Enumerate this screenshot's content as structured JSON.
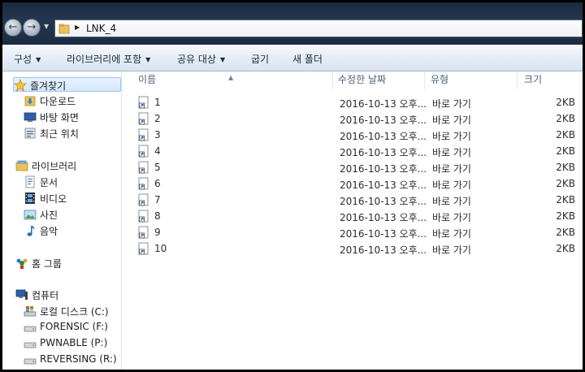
{
  "address": {
    "path": "LNK_4"
  },
  "toolbar": {
    "organize": "구성",
    "include_library": "라이브러리에 포함",
    "share_with": "공유 대상",
    "burn": "굽기",
    "new_folder": "새 폴더"
  },
  "nav": {
    "favorites": "즐겨찾기",
    "downloads": "다운로드",
    "desktop": "바탕 화면",
    "recent": "최근 위치",
    "libraries": "라이브러리",
    "documents": "문서",
    "videos": "비디오",
    "pictures": "사진",
    "music": "음악",
    "homegroup": "홈 그룹",
    "computer": "컴퓨터",
    "local_disk": "로컬 디스크 (C:)",
    "drive_f": "FORENSIC (F:)",
    "drive_p": "PWNABLE (P:)",
    "drive_r": "REVERSING (R:)"
  },
  "columns": {
    "name": "이름",
    "modified": "수정한 날짜",
    "type": "유형",
    "size": "크기"
  },
  "files": [
    {
      "name": "1",
      "modified": "2016-10-13 오후...",
      "type": "바로 가기",
      "size": "2KB"
    },
    {
      "name": "2",
      "modified": "2016-10-13 오후...",
      "type": "바로 가기",
      "size": "2KB"
    },
    {
      "name": "3",
      "modified": "2016-10-13 오후...",
      "type": "바로 가기",
      "size": "2KB"
    },
    {
      "name": "4",
      "modified": "2016-10-13 오후...",
      "type": "바로 가기",
      "size": "2KB"
    },
    {
      "name": "5",
      "modified": "2016-10-13 오후...",
      "type": "바로 가기",
      "size": "2KB"
    },
    {
      "name": "6",
      "modified": "2016-10-13 오후...",
      "type": "바로 가기",
      "size": "2KB"
    },
    {
      "name": "7",
      "modified": "2016-10-13 오후...",
      "type": "바로 가기",
      "size": "2KB"
    },
    {
      "name": "8",
      "modified": "2016-10-13 오후...",
      "type": "바로 가기",
      "size": "2KB"
    },
    {
      "name": "9",
      "modified": "2016-10-13 오후...",
      "type": "바로 가기",
      "size": "2KB"
    },
    {
      "name": "10",
      "modified": "2016-10-13 오후...",
      "type": "바로 가기",
      "size": "2KB"
    }
  ],
  "colors": {
    "selection": "#d3e7fd",
    "toolbar": "#e4ecf6",
    "header_text": "#4c607a"
  }
}
